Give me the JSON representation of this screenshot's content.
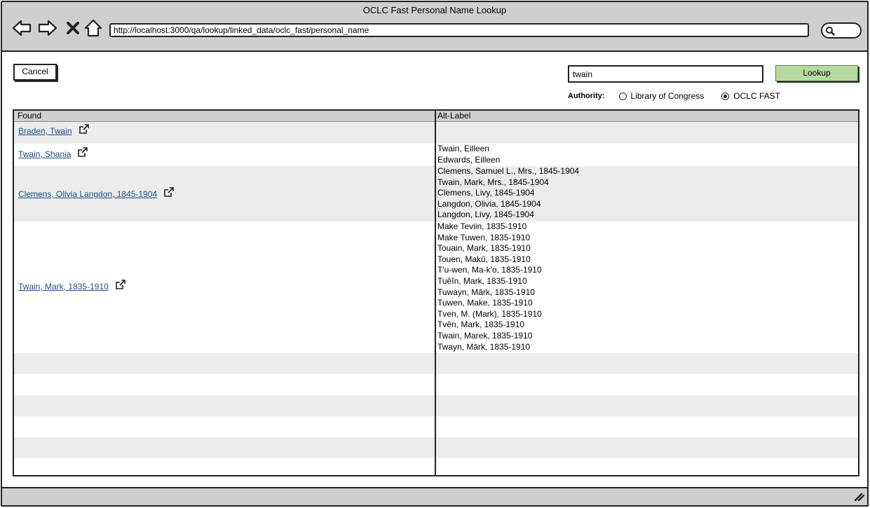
{
  "window": {
    "title": "OCLC Fast Personal Name Lookup",
    "url": "http://localhost:3000/qa/lookup/linked_data/oclc_fast/personal_name"
  },
  "toolbar": {
    "back_icon": "arrow-left-icon",
    "forward_icon": "arrow-right-icon",
    "stop_icon": "close-icon",
    "home_icon": "home-icon",
    "search_icon": "search-icon"
  },
  "form": {
    "cancel_label": "Cancel",
    "query_value": "twain",
    "lookup_label": "Lookup",
    "lookup_color": "#b6dba0",
    "authority_label": "Authority:",
    "authority_options": [
      {
        "label": "Library of Congress",
        "checked": false
      },
      {
        "label": "OCLC FAST",
        "checked": true
      }
    ]
  },
  "table": {
    "headers": {
      "found": "Found",
      "alt_label": "Alt-Label"
    },
    "link_color": "#1f4e85",
    "rows": [
      {
        "found": "Braden, Twain",
        "alt_labels": []
      },
      {
        "found": "Twain, Shania",
        "alt_labels": [
          "Twain, Eilleen",
          "Edwards, Eilleen"
        ]
      },
      {
        "found": "Clemens, Olivia Langdon, 1845-1904",
        "alt_labels": [
          "Clemens, Samuel L., Mrs., 1845-1904",
          "Twain, Mark, Mrs., 1845-1904",
          "Clemens, Livy, 1845-1904",
          "Langdon, Olivia, 1845-1904",
          "Langdon, Livy, 1845-1904"
        ]
      },
      {
        "found": "Twain, Mark, 1835-1910",
        "alt_labels": [
          "Make Teviin, 1835-1910",
          "Make Tuwen, 1835-1910",
          "Touain, Mark, 1835-1910",
          "Touen, Makū, 1835-1910",
          "T'u-wen, Ma-k'o, 1835-1910",
          "Tuêĭn, Mark, 1835-1910",
          "Tuwayn, Mārk, 1835-1910",
          "Tuwen, Make, 1835-1910",
          "Tven, M. (Mark), 1835-1910",
          "Tvên, Mark, 1835-1910",
          "Twain, Marek, 1835-1910",
          "Twayn, Mārk, 1835-1910"
        ]
      }
    ]
  },
  "statusbar": {
    "resize_icon": "resize-grip-icon"
  }
}
